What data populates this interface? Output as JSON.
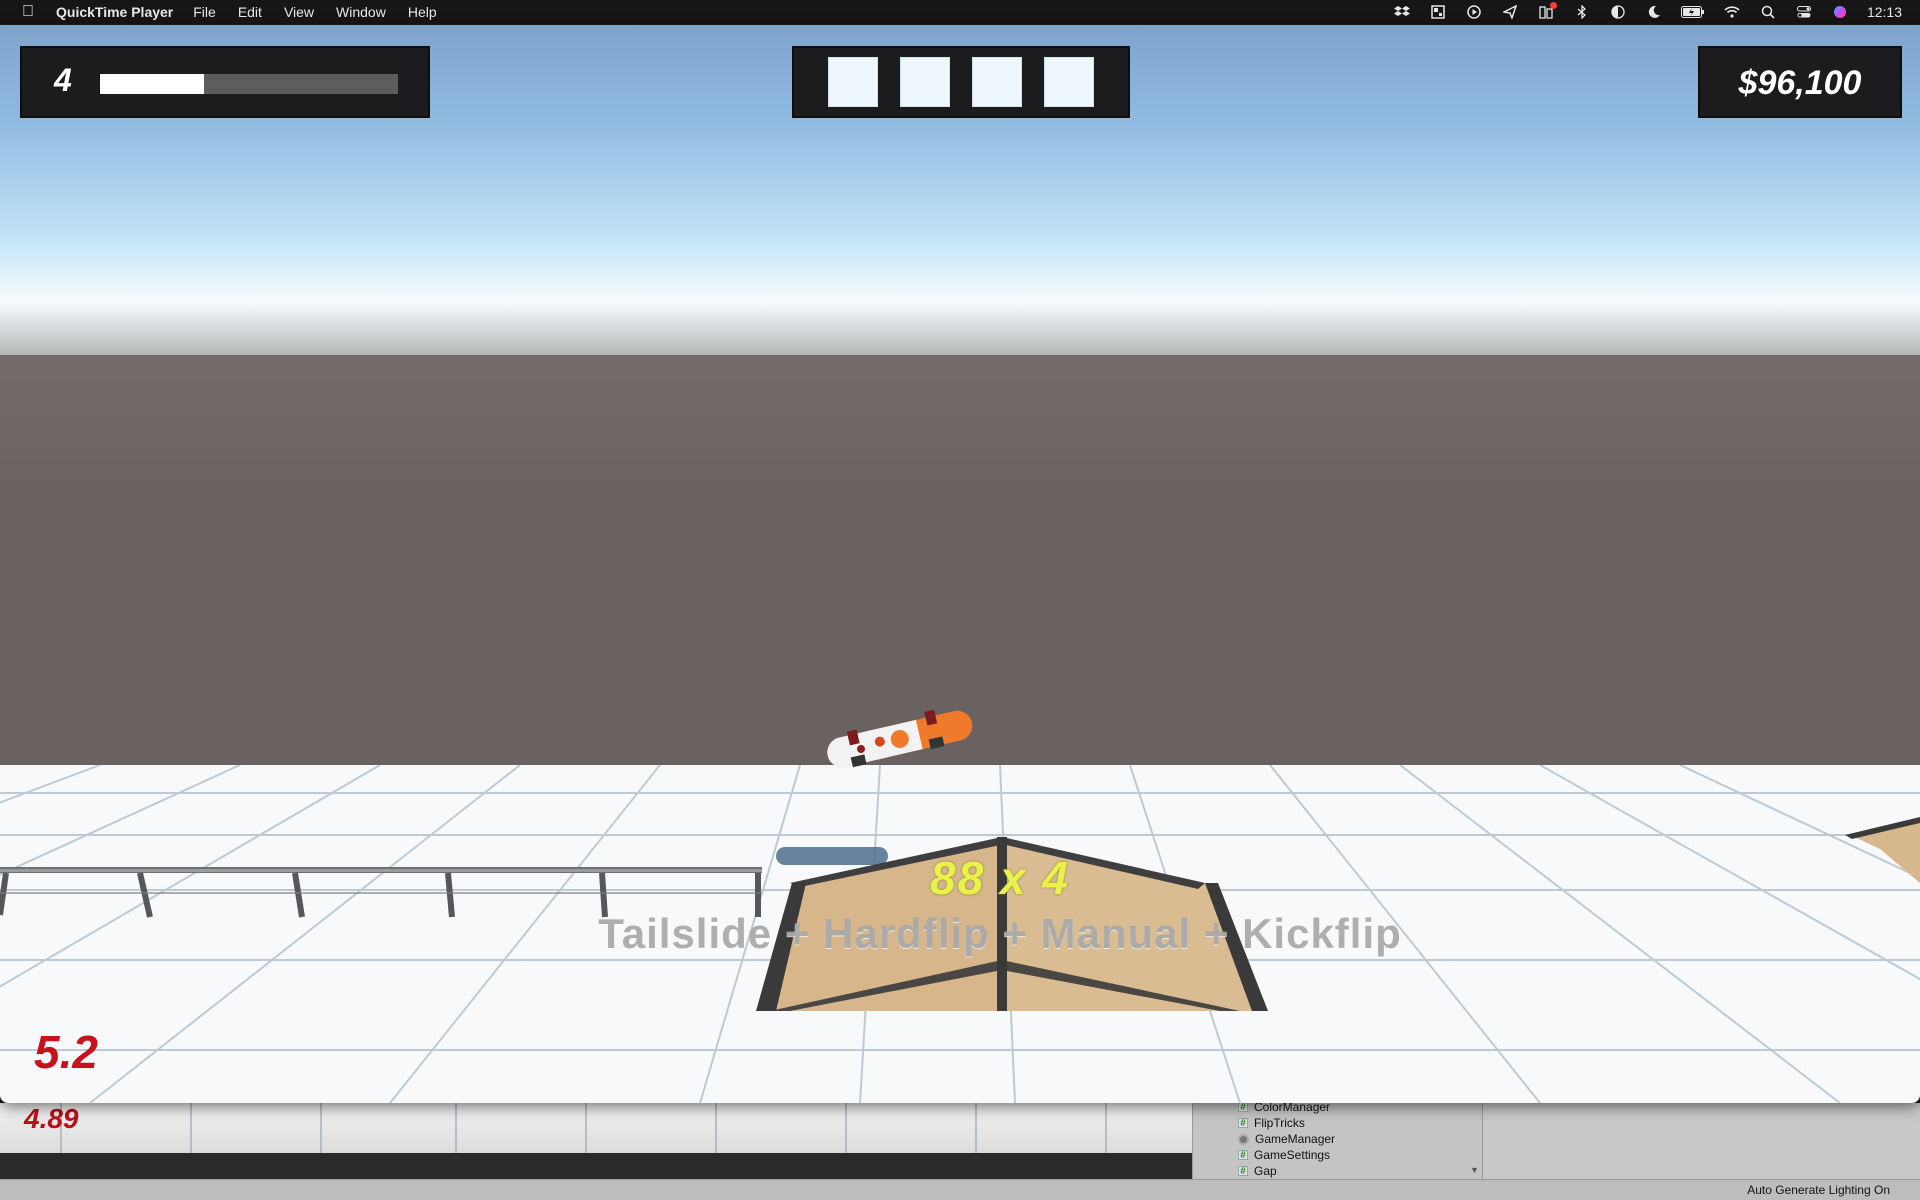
{
  "menubar": {
    "apple_icon": "apple-logo-icon",
    "app_name": "QuickTime Player",
    "menus": [
      "File",
      "Edit",
      "View",
      "Window",
      "Help"
    ],
    "status_icons": [
      "dropbox-icon",
      "window-grid-icon",
      "play-circle-icon",
      "send-arrow-icon",
      "phone-notification-icon",
      "bluetooth-icon",
      "contrast-icon",
      "moon-icon",
      "battery-icon",
      "wifi-icon",
      "search-icon",
      "control-center-icon",
      "siri-icon"
    ],
    "clock": "12:13",
    "notification_color": "#ff3b30"
  },
  "hud": {
    "level": "4",
    "level_progress": 0.35,
    "letter_slots": 4,
    "money": "$96,100"
  },
  "combo": {
    "score": "88 x 4",
    "tricks": "Tailslide + Hardflip + Manual + Kickflip"
  },
  "fps": "5.2",
  "editor": {
    "fps_value": "4.89",
    "project_items": [
      {
        "name": "ColorManager",
        "icon": "script-icon"
      },
      {
        "name": "FlipTricks",
        "icon": "script-icon"
      },
      {
        "name": "GameManager",
        "icon": "gear-icon"
      },
      {
        "name": "GameSettings",
        "icon": "script-icon"
      },
      {
        "name": "Gap",
        "icon": "script-icon"
      }
    ],
    "status_text": "Auto Generate Lighting On"
  },
  "colors": {
    "hud_bg": "#1c1c1f",
    "combo_yellow": "#eaf24a",
    "fps_red": "#c8121c",
    "ramp_wood": "#d2b48c",
    "board_orange": "#f07a2c"
  }
}
